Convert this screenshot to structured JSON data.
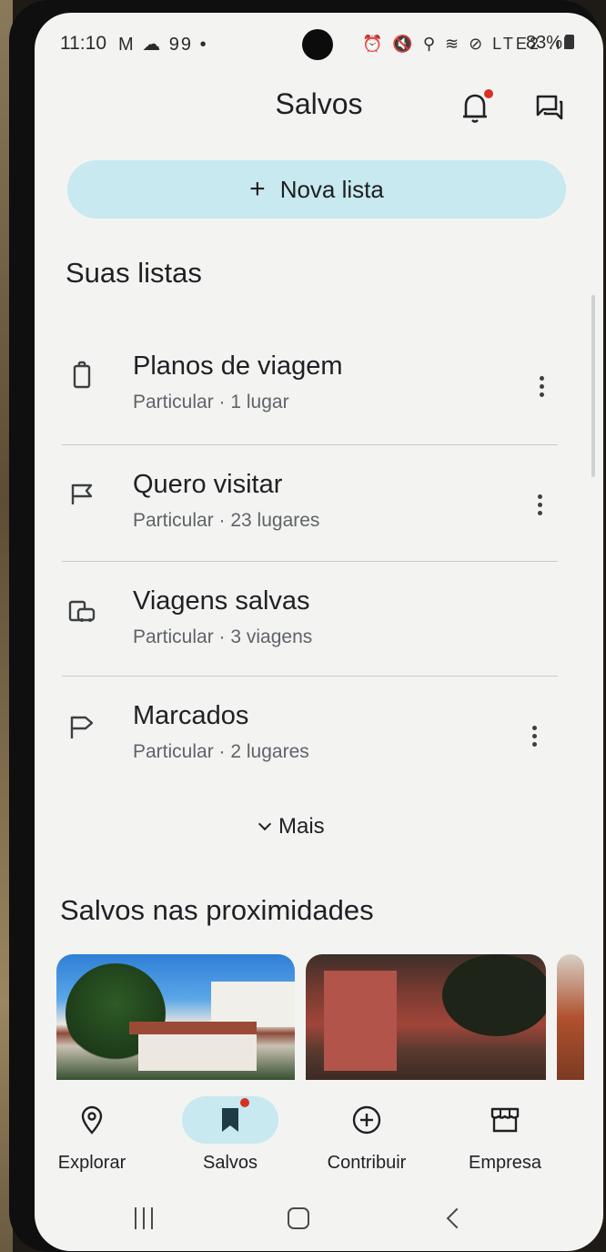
{
  "status_bar": {
    "time": "11:10",
    "left_icons": "M ☁ 99 •",
    "right_icons": "⏰ 🔇 ⚲ ≋ ⊘ LTE2 .ıl",
    "battery": "83%"
  },
  "header": {
    "title": "Salvos"
  },
  "new_list": {
    "plus": "+",
    "label": "Nova lista"
  },
  "your_lists": {
    "title": "Suas listas",
    "items": [
      {
        "name": "Planos de viagem",
        "meta": "Particular · 1 lugar",
        "icon": "luggage-icon"
      },
      {
        "name": "Quero visitar",
        "meta": "Particular · 23 lugares",
        "icon": "flag-icon"
      },
      {
        "name": "Viagens salvas",
        "meta": "Particular · 3 viagens",
        "icon": "trips-icon"
      },
      {
        "name": "Marcados",
        "meta": "Particular · 2 lugares",
        "icon": "starred-flag-icon"
      }
    ],
    "more_label": "Mais"
  },
  "nearby": {
    "title": "Salvos nas proximidades"
  },
  "bottom_nav": {
    "items": [
      {
        "label": "Explorar",
        "icon": "location-pin-icon"
      },
      {
        "label": "Salvos",
        "icon": "bookmark-icon"
      },
      {
        "label": "Contribuir",
        "icon": "add-circle-icon"
      },
      {
        "label": "Empresa",
        "icon": "storefront-icon"
      }
    ],
    "active_index": 1
  },
  "colors": {
    "accent": "#c7e9ef",
    "badge": "#d93025",
    "text_primary": "#202124",
    "text_secondary": "#5f6368"
  }
}
